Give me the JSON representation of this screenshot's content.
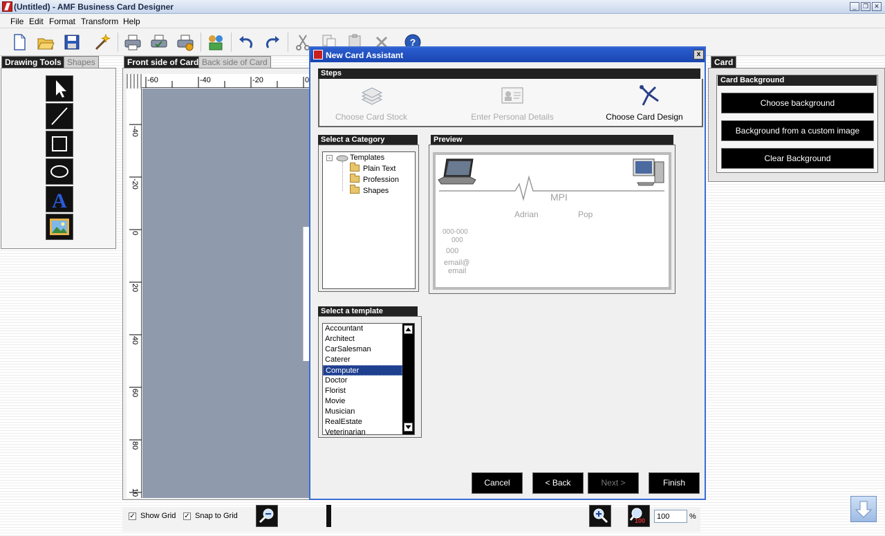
{
  "window": {
    "title": "(Untitled) - AMF Business Card Designer"
  },
  "menu": [
    "File",
    "Edit",
    "Format",
    "Transform",
    "Help"
  ],
  "left_tabs": {
    "drawing_tools": "Drawing Tools",
    "shapes": "Shapes"
  },
  "canvas_tabs": {
    "front": "Front side of Card",
    "back": "Back side of Card"
  },
  "ruler": {
    "h_labels": [
      "-60",
      "-40",
      "-20",
      "0"
    ],
    "v_labels": [
      "-40",
      "-20",
      "0",
      "20",
      "40",
      "60",
      "80",
      "10"
    ]
  },
  "bottom": {
    "show_grid": "Show Grid",
    "snap_to_grid": "Snap to Grid",
    "zoom_value": "100",
    "percent": "%",
    "zoom_icon_100": "100"
  },
  "card_panel": {
    "tab": "Card",
    "group_title": "Card Background",
    "buttons": [
      "Choose background",
      "Background from a custom image",
      "Clear Background"
    ]
  },
  "dialog": {
    "title": "New Card Assistant",
    "close": "x",
    "steps_title": "Steps",
    "steps": [
      {
        "label": "Choose Card Stock",
        "state": "done"
      },
      {
        "label": "Enter Personal Details",
        "state": "done"
      },
      {
        "label": "Choose Card Design",
        "state": "current"
      }
    ],
    "category_title": "Select a Category",
    "tree": {
      "root": "Templates",
      "children": [
        "Plain Text",
        "Profession",
        "Shapes"
      ]
    },
    "preview_title": "Preview",
    "preview": {
      "company": "MPI",
      "first_name": "Adrian",
      "last_name": "Pop",
      "phone1": "000-000",
      "phone2": "000",
      "phone3": "000",
      "email1": "email@",
      "email2": "email"
    },
    "template_title": "Select a template",
    "templates": [
      "Accountant",
      "Architect",
      "CarSalesman",
      "Caterer",
      "Computer",
      "Doctor",
      "Florist",
      "Movie",
      "Musician",
      "RealEstate",
      "Veterinarian"
    ],
    "selected_template": "Computer",
    "buttons": {
      "cancel": "Cancel",
      "back": "< Back",
      "next": "Next >",
      "finish": "Finish"
    }
  },
  "colors": {
    "title_blue": "#2b5ed0",
    "selection": "#1f3f8f",
    "canvas": "#909aad"
  }
}
